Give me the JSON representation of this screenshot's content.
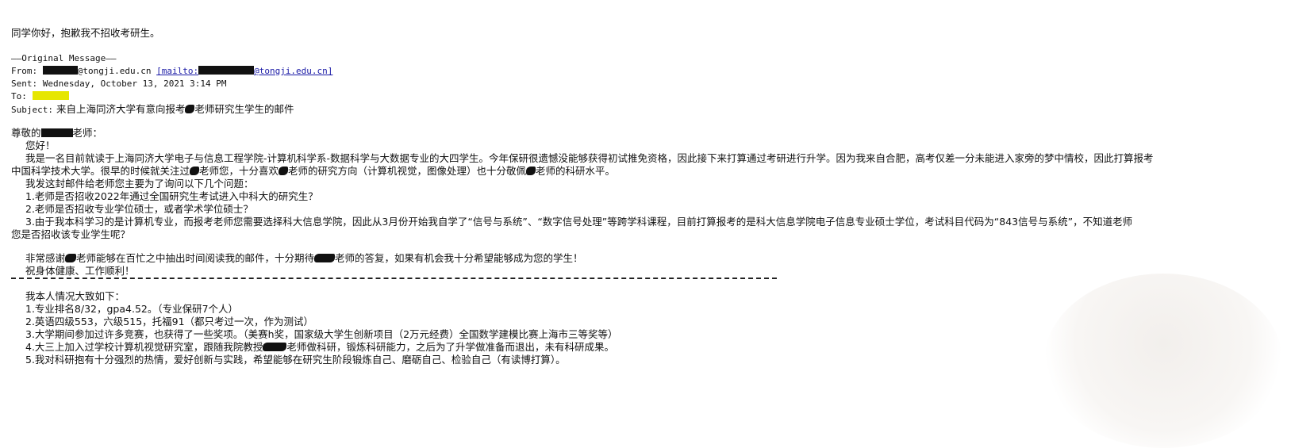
{
  "reply": {
    "text": "同学你好，抱歉我不招收考研生。"
  },
  "header": {
    "original_message": "——Original Message——",
    "from_label": "From:",
    "from_value": "@tongji.edu.cn",
    "from_link_prefix": "[mailto:",
    "from_link_suffix": "@tongji.edu.cn]",
    "sent_label": "Sent:",
    "sent_value": "Wednesday, October 13, 2021 3:14 PM",
    "to_label": "To:",
    "subject_label": "Subject:",
    "subject_part1": "来自上海同济大学有意向报考",
    "subject_part2": "老师研究生学生的邮件"
  },
  "body": {
    "salutation_prefix": "尊敬的",
    "salutation_suffix": "老师：",
    "greeting": "您好！",
    "para1_line1": "我是一名目前就读于上海同济大学电子与信息工程学院-计算机科学系-数据科学与大数据专业的大四学生。今年保研很遗憾没能够获得初试推免资格，因此接下来打算通过考研进行升学。因为我来自合肥，高考仅差一分未能进入家旁的梦中情校，因此打算报考",
    "para1_line2_a": "中国科学技术大学。很早的时候就关注过",
    "para1_line2_b": "老师您，十分喜欢",
    "para1_line2_c": "老师的研究方向（计算机视觉，图像处理）也十分敬佩",
    "para1_line2_d": "老师的科研水平。",
    "para2": "我发这封邮件给老师您主要为了询问以下几个问题：",
    "q1": "1.老师是否招收2022年通过全国研究生考试进入中科大的研究生？",
    "q2": "2.老师是否招收专业学位硕士，或者学术学位硕士？",
    "q3_line1": "3.由于我本科学习的是计算机专业，而报考老师您需要选择科大信息学院，因此从3月份开始我自学了“信号与系统”、“数字信号处理”等跨学科课程，目前打算报考的是科大信息学院电子信息专业硕士学位，考试科目代码为“843信号与系统”，不知道老师",
    "q3_line2": "您是否招收该专业学生呢？",
    "thanks_a": "非常感谢",
    "thanks_b": "老师能够在百忙之中抽出时间阅读我的邮件，十分期待",
    "thanks_c": "老师的答复，如果有机会我十分希望能够成为您的学生！",
    "closing": "祝身体健康、工作顺利！"
  },
  "profile": {
    "intro": "我本人情况大致如下：",
    "item1": "1.专业排名8/32，gpa4.52。（专业保研7个人）",
    "item2": "2.英语四级553，六级515，托福91（都只考过一次，作为测试）",
    "item3": "3.大学期间参加过许多竞赛，也获得了一些奖项。（美赛h奖，国家级大学生创新项目（2万元经费）全国数学建模比赛上海市三等奖等）",
    "item4_a": "4.大三上加入过学校计算机视觉研究室，跟随我院教授",
    "item4_b": "老师做科研，锻炼科研能力，之后为了升学做准备而退出，未有科研成果。",
    "item5": "5.我对科研抱有十分强烈的热情，爱好创新与实践，希望能够在研究生阶段锻炼自己、磨砺自己、检验自己（有读博打算）。"
  }
}
